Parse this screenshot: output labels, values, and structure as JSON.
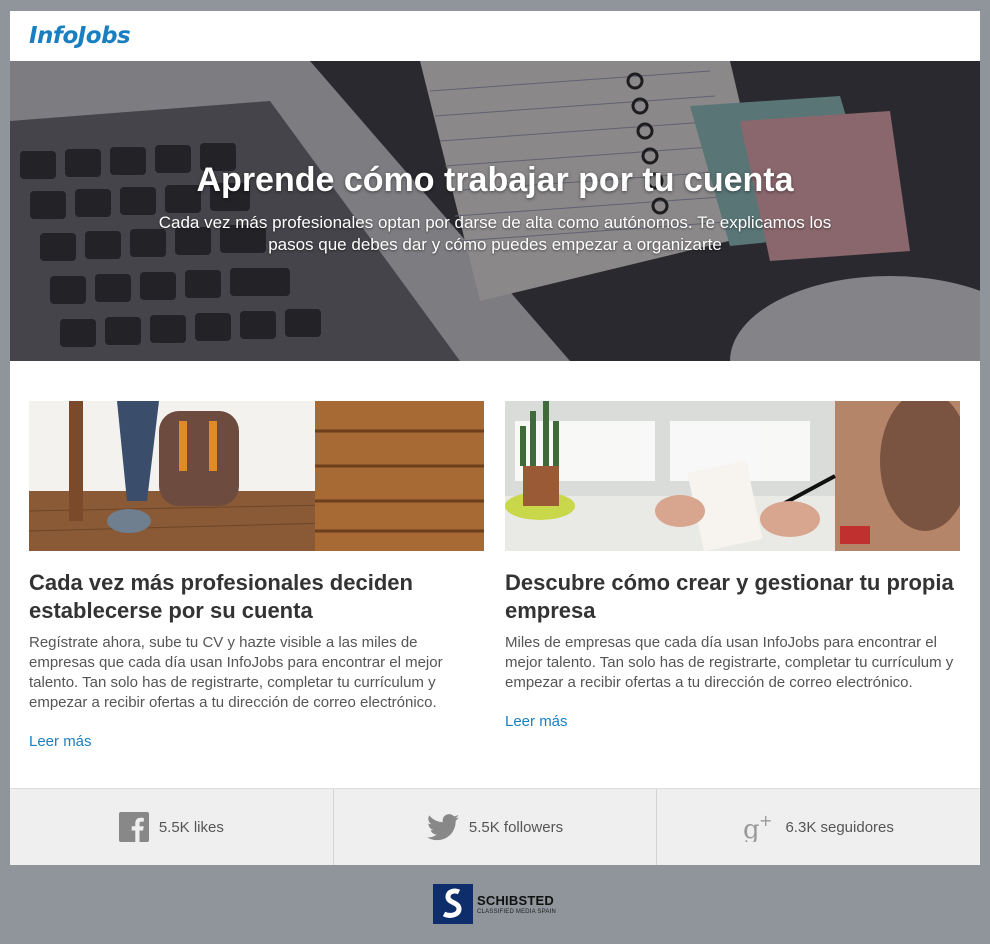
{
  "header": {
    "logo_text": "InfoJobs"
  },
  "hero": {
    "title": "Aprende cómo trabajar por tu cuenta",
    "subtitle": "Cada vez más profesionales optan por darse de alta como autónomos. Te explicamos los pasos que debes dar y cómo puedes empezar a organizarte"
  },
  "articles": [
    {
      "title": "Cada vez más profesionales deciden establecerse por su cuenta",
      "body": "Regístrate ahora, sube tu CV y hazte visible a las miles de empresas que cada día usan InfoJobs para encontrar el mejor talento. Tan solo has de registrarte, completar tu currículum y empezar a recibir ofertas a tu dirección de correo electrónico.",
      "link": "Leer más"
    },
    {
      "title": "Descubre cómo crear y gestionar tu propia empresa",
      "body": "Miles de empresas que cada día usan InfoJobs para encontrar el mejor talento. Tan solo has de registrarte, completar tu currículum y empezar a recibir ofertas a tu dirección de correo electrónico.",
      "link": "Leer más"
    }
  ],
  "social": {
    "facebook": {
      "icon": "facebook-icon",
      "count": "5.5K likes"
    },
    "twitter": {
      "icon": "twitter-icon",
      "count": "5.5K followers"
    },
    "googleplus": {
      "icon": "google-plus-icon",
      "count": "6.3K seguidores"
    }
  },
  "footer": {
    "brand": "SCHIBSTED",
    "tagline": "CLASSIFIED MEDIA SPAIN"
  },
  "colors": {
    "accent": "#1a7fc1",
    "background": "#8f959a",
    "social_bar": "#efefef",
    "schibsted_blue": "#0d2e6b"
  }
}
